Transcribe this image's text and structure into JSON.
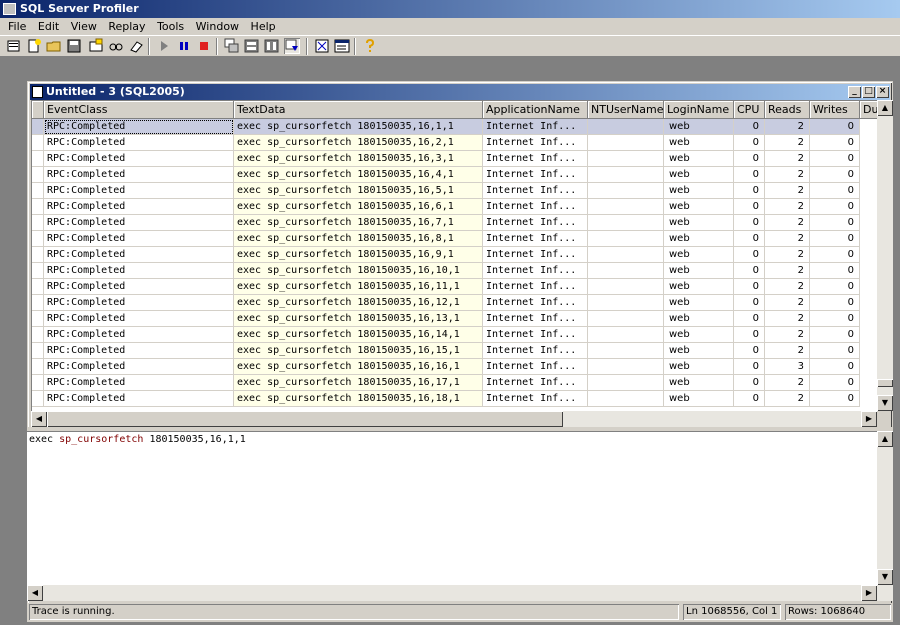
{
  "app": {
    "title": "SQL Server Profiler"
  },
  "menu": [
    "File",
    "Edit",
    "View",
    "Replay",
    "Tools",
    "Window",
    "Help"
  ],
  "toolbar_icons": [
    "new-trace-icon",
    "new-template-icon",
    "open-icon",
    "save-icon",
    "properties-icon",
    "find-icon",
    "clear-icon",
    "run-icon",
    "pause-icon",
    "stop-icon",
    "cascade-icon",
    "tile-icon",
    "columns-icon",
    "auto-scroll-icon",
    "options-icon",
    "grid-icon",
    "help-icon"
  ],
  "child": {
    "title": "Untitled - 3 (SQL2005)"
  },
  "columns": [
    "EventClass",
    "TextData",
    "ApplicationName",
    "NTUserName",
    "LoginName",
    "CPU",
    "Reads",
    "Writes",
    "Du"
  ],
  "rows": [
    {
      "event": "RPC:Completed",
      "text": "exec sp_cursorfetch 180150035,16,1,1",
      "app": "Internet Inf...",
      "nt": "",
      "login": "web",
      "cpu": "0",
      "reads": "2",
      "writes": "0"
    },
    {
      "event": "RPC:Completed",
      "text": "exec sp_cursorfetch 180150035,16,2,1",
      "app": "Internet Inf...",
      "nt": "",
      "login": "web",
      "cpu": "0",
      "reads": "2",
      "writes": "0"
    },
    {
      "event": "RPC:Completed",
      "text": "exec sp_cursorfetch 180150035,16,3,1",
      "app": "Internet Inf...",
      "nt": "",
      "login": "web",
      "cpu": "0",
      "reads": "2",
      "writes": "0"
    },
    {
      "event": "RPC:Completed",
      "text": "exec sp_cursorfetch 180150035,16,4,1",
      "app": "Internet Inf...",
      "nt": "",
      "login": "web",
      "cpu": "0",
      "reads": "2",
      "writes": "0"
    },
    {
      "event": "RPC:Completed",
      "text": "exec sp_cursorfetch 180150035,16,5,1",
      "app": "Internet Inf...",
      "nt": "",
      "login": "web",
      "cpu": "0",
      "reads": "2",
      "writes": "0"
    },
    {
      "event": "RPC:Completed",
      "text": "exec sp_cursorfetch 180150035,16,6,1",
      "app": "Internet Inf...",
      "nt": "",
      "login": "web",
      "cpu": "0",
      "reads": "2",
      "writes": "0"
    },
    {
      "event": "RPC:Completed",
      "text": "exec sp_cursorfetch 180150035,16,7,1",
      "app": "Internet Inf...",
      "nt": "",
      "login": "web",
      "cpu": "0",
      "reads": "2",
      "writes": "0"
    },
    {
      "event": "RPC:Completed",
      "text": "exec sp_cursorfetch 180150035,16,8,1",
      "app": "Internet Inf...",
      "nt": "",
      "login": "web",
      "cpu": "0",
      "reads": "2",
      "writes": "0"
    },
    {
      "event": "RPC:Completed",
      "text": "exec sp_cursorfetch 180150035,16,9,1",
      "app": "Internet Inf...",
      "nt": "",
      "login": "web",
      "cpu": "0",
      "reads": "2",
      "writes": "0"
    },
    {
      "event": "RPC:Completed",
      "text": "exec sp_cursorfetch 180150035,16,10,1",
      "app": "Internet Inf...",
      "nt": "",
      "login": "web",
      "cpu": "0",
      "reads": "2",
      "writes": "0"
    },
    {
      "event": "RPC:Completed",
      "text": "exec sp_cursorfetch 180150035,16,11,1",
      "app": "Internet Inf...",
      "nt": "",
      "login": "web",
      "cpu": "0",
      "reads": "2",
      "writes": "0"
    },
    {
      "event": "RPC:Completed",
      "text": "exec sp_cursorfetch 180150035,16,12,1",
      "app": "Internet Inf...",
      "nt": "",
      "login": "web",
      "cpu": "0",
      "reads": "2",
      "writes": "0"
    },
    {
      "event": "RPC:Completed",
      "text": "exec sp_cursorfetch 180150035,16,13,1",
      "app": "Internet Inf...",
      "nt": "",
      "login": "web",
      "cpu": "0",
      "reads": "2",
      "writes": "0"
    },
    {
      "event": "RPC:Completed",
      "text": "exec sp_cursorfetch 180150035,16,14,1",
      "app": "Internet Inf...",
      "nt": "",
      "login": "web",
      "cpu": "0",
      "reads": "2",
      "writes": "0"
    },
    {
      "event": "RPC:Completed",
      "text": "exec sp_cursorfetch 180150035,16,15,1",
      "app": "Internet Inf...",
      "nt": "",
      "login": "web",
      "cpu": "0",
      "reads": "2",
      "writes": "0"
    },
    {
      "event": "RPC:Completed",
      "text": "exec sp_cursorfetch 180150035,16,16,1",
      "app": "Internet Inf...",
      "nt": "",
      "login": "web",
      "cpu": "0",
      "reads": "3",
      "writes": "0"
    },
    {
      "event": "RPC:Completed",
      "text": "exec sp_cursorfetch 180150035,16,17,1",
      "app": "Internet Inf...",
      "nt": "",
      "login": "web",
      "cpu": "0",
      "reads": "2",
      "writes": "0"
    },
    {
      "event": "RPC:Completed",
      "text": "exec sp_cursorfetch 180150035,16,18,1",
      "app": "Internet Inf...",
      "nt": "",
      "login": "web",
      "cpu": "0",
      "reads": "2",
      "writes": "0"
    }
  ],
  "selected_row": 0,
  "detail": {
    "keyword": "exec",
    "proc": "sp_cursorfetch",
    "args": "180150035,16,1,1"
  },
  "status": {
    "message": "Trace is running.",
    "position": "Ln 1068556, Col 1",
    "rows": "Rows: 1068640"
  },
  "colors": {
    "title_start": "#0a246a",
    "title_end": "#a6caf0",
    "selected_row": "#c8cce0",
    "textdata_bg": "#ffffe8",
    "proc_name": "#800000"
  }
}
